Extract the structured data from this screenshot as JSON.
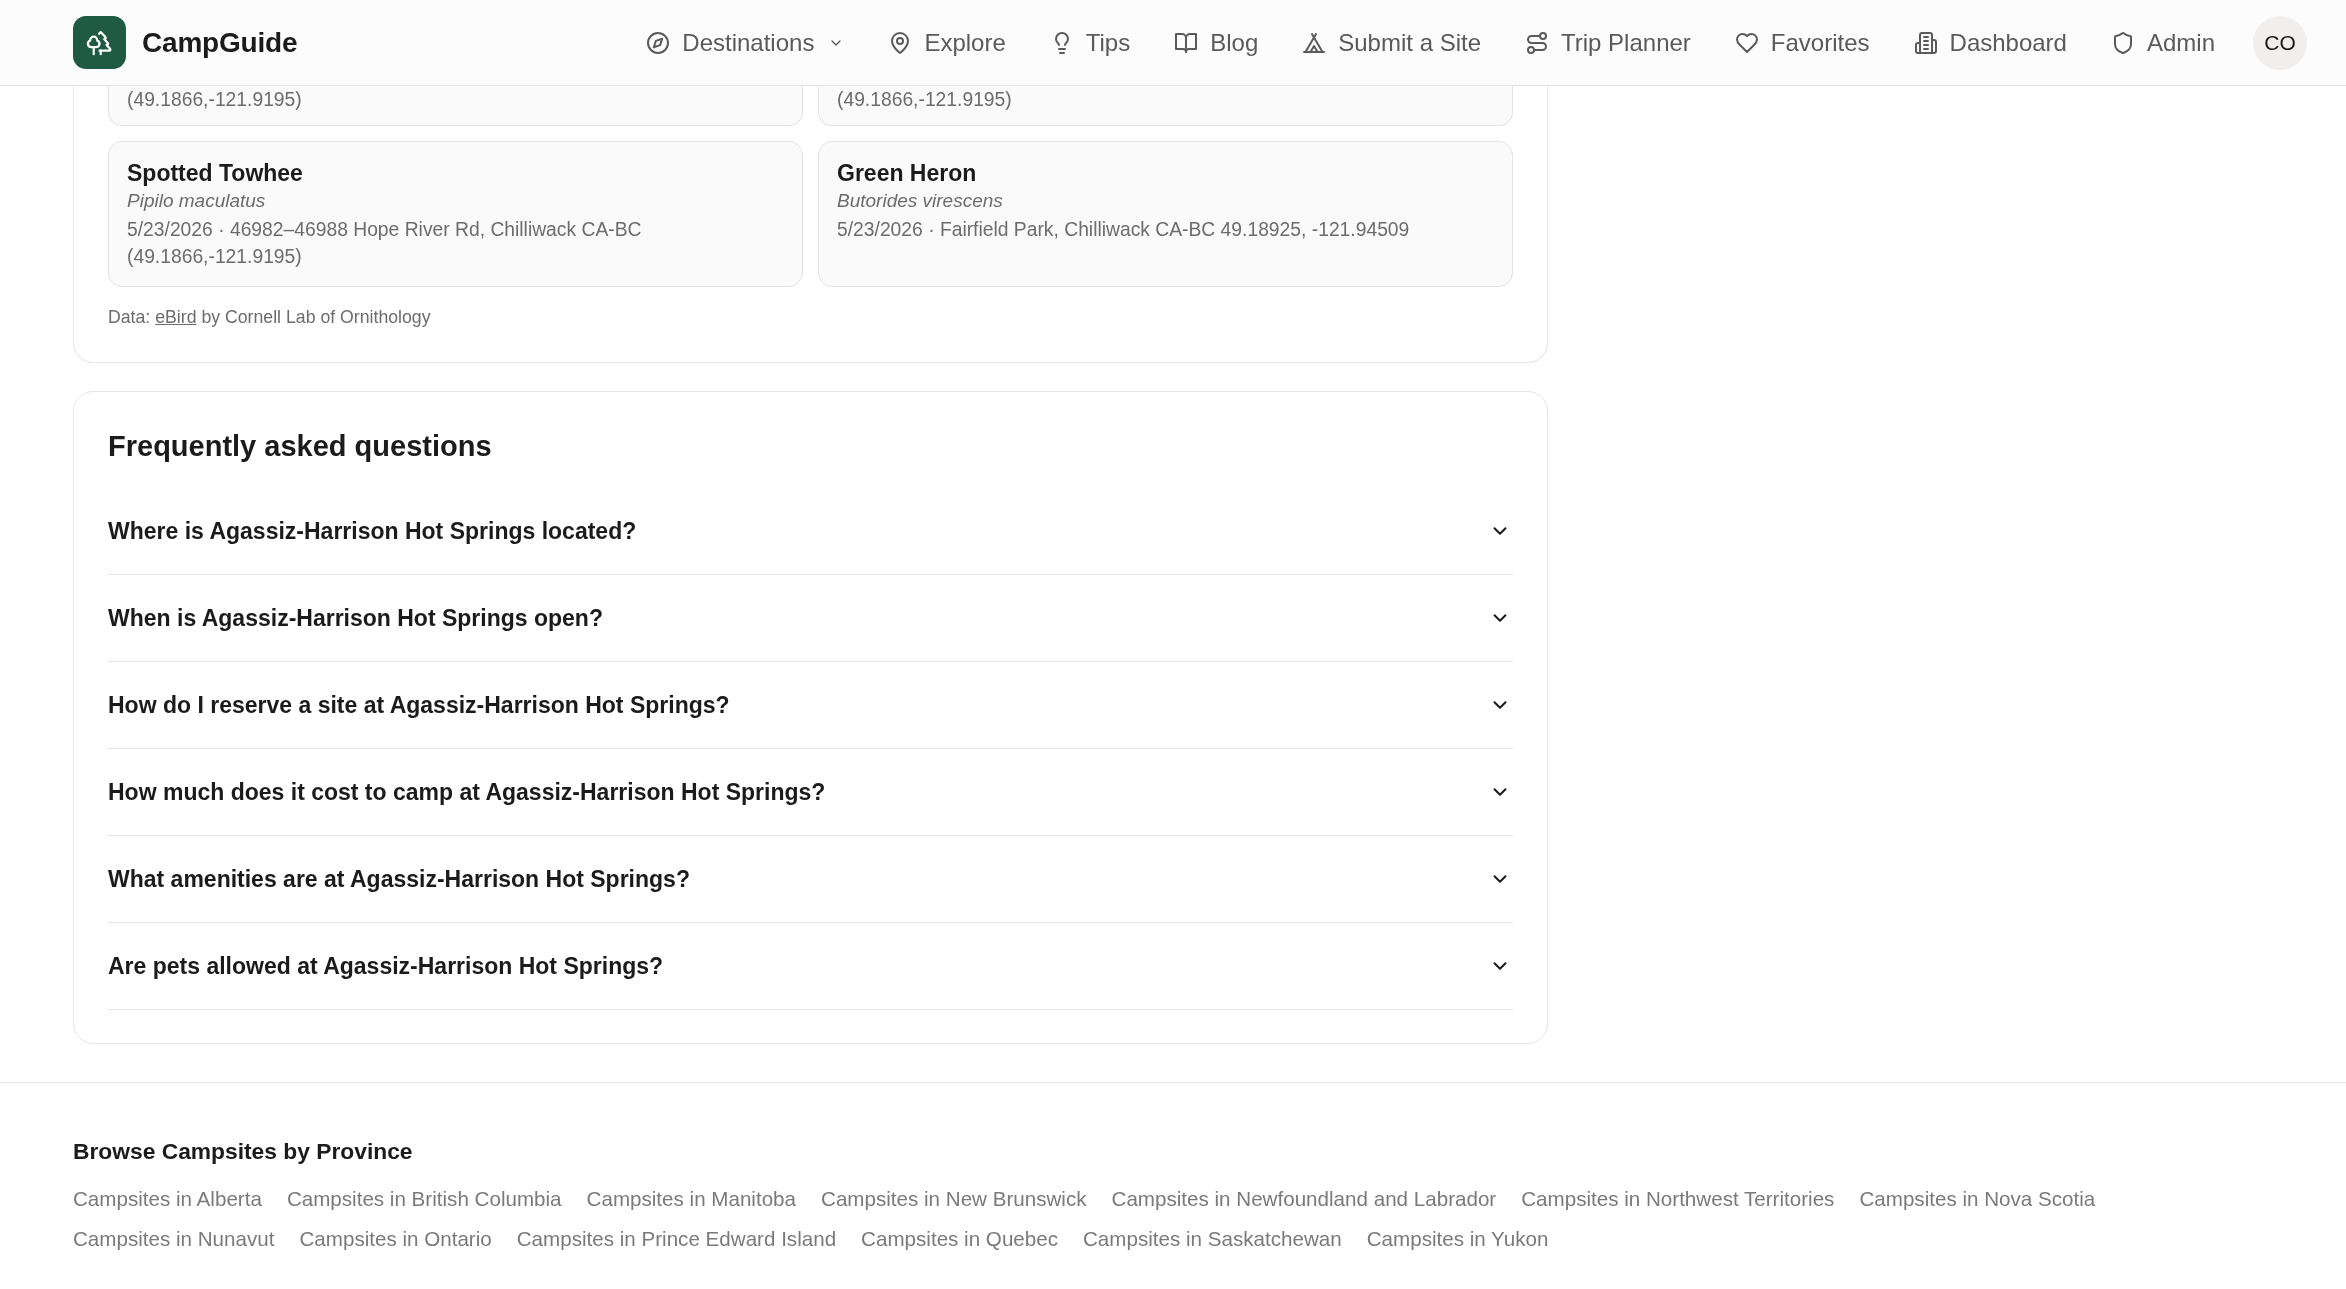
{
  "navbar": {
    "brand": "CampGuide",
    "items": [
      {
        "label": "Destinations",
        "dropdown": true
      },
      {
        "label": "Explore",
        "dropdown": false
      },
      {
        "label": "Tips",
        "dropdown": false
      },
      {
        "label": "Blog",
        "dropdown": false
      },
      {
        "label": "Submit a Site",
        "dropdown": false
      },
      {
        "label": "Trip Planner",
        "dropdown": false
      },
      {
        "label": "Favorites",
        "dropdown": false
      },
      {
        "label": "Dashboard",
        "dropdown": false
      },
      {
        "label": "Admin",
        "dropdown": false
      }
    ],
    "avatar": "CO"
  },
  "sightings": {
    "cards": [
      {
        "kind": "clipped",
        "details": "(49.1866,-121.9195)"
      },
      {
        "kind": "clipped",
        "details": "(49.1866,-121.9195)"
      },
      {
        "kind": "full",
        "name": "Spotted Towhee",
        "scientific_name": "Pipilo maculatus",
        "details": "5/23/2026 · 46982–46988 Hope River Rd, Chilliwack CA-BC (49.1866,-121.9195)"
      },
      {
        "kind": "full",
        "name": "Green Heron",
        "scientific_name": "Butorides virescens",
        "details": "5/23/2026 · Fairfield Park, Chilliwack CA-BC 49.18925, -121.94509"
      }
    ],
    "credit": {
      "before": "Data:",
      "link": "eBird",
      "after": "by Cornell Lab of Ornithology"
    }
  },
  "faq": {
    "title": "Frequently asked questions",
    "items": [
      {
        "question": "Where is Agassiz-Harrison Hot Springs located?",
        "expanded": false
      },
      {
        "question": "When is Agassiz-Harrison Hot Springs open?",
        "expanded": false
      },
      {
        "question": "How do I reserve a site at Agassiz-Harrison Hot Springs?",
        "expanded": false
      },
      {
        "question": "How much does it cost to camp at Agassiz-Harrison Hot Springs?",
        "expanded": false
      },
      {
        "question": "What amenities are at Agassiz-Harrison Hot Springs?",
        "expanded": false
      },
      {
        "question": "Are pets allowed at Agassiz-Harrison Hot Springs?",
        "expanded": false
      }
    ]
  },
  "footer": {
    "title": "Browse Campsites by Province",
    "links": [
      "Campsites in Alberta",
      "Campsites in British Columbia",
      "Campsites in Manitoba",
      "Campsites in New Brunswick",
      "Campsites in Newfoundland and Labrador",
      "Campsites in Northwest Territories",
      "Campsites in Nova Scotia",
      "Campsites in Nunavut",
      "Campsites in Ontario",
      "Campsites in Prince Edward Island",
      "Campsites in Quebec",
      "Campsites in Saskatchewan",
      "Campsites in Yukon"
    ]
  }
}
